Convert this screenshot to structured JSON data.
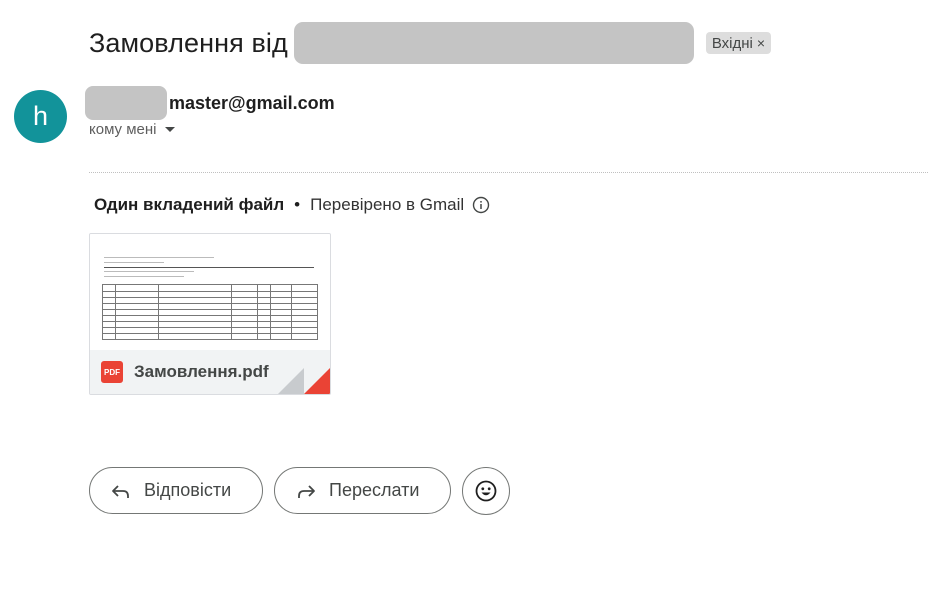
{
  "subject": {
    "text": "Замовлення від",
    "label_chip": "Вхідні",
    "label_remove": "×"
  },
  "sender": {
    "avatar_letter": "h",
    "email_visible": "master@gmail.com",
    "recipient": "кому мені"
  },
  "attachments": {
    "header_count": "Один вкладений файл",
    "separator": "•",
    "verified_text": "Перевірено в Gmail",
    "file": {
      "name": "Замовлення.pdf",
      "type_badge": "PDF"
    }
  },
  "actions": {
    "reply_label": "Відповісти",
    "forward_label": "Переслати"
  },
  "colors": {
    "avatar_bg": "#12939a",
    "pdf_red": "#ea4335",
    "chip_bg": "#dddddd"
  },
  "icons": [
    "info-icon",
    "caret-down-icon",
    "pdf-icon",
    "reply-icon",
    "forward-icon",
    "emoji-icon"
  ]
}
